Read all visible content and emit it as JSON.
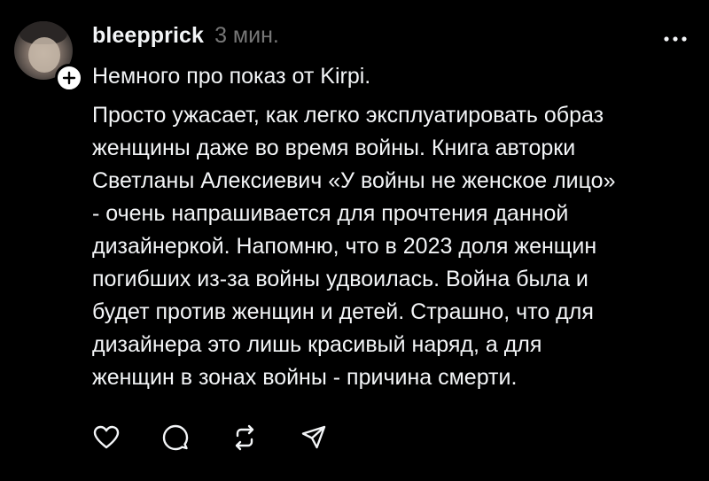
{
  "post": {
    "username": "bleepprick",
    "timestamp": "3 мин.",
    "lead": "Немного про показ от Kirpi.",
    "body_lines": [
      "Просто ужасает, как легко эксплуатировать образ",
      "женщины даже во время войны. Книга авторки",
      "Светланы Алексиевич «У войны не женское лицо»",
      "- очень напрашивается для прочтения данной",
      "дизайнеркой. Напомню, что в 2023 доля женщин",
      "погибших из-за войны удвоилась. Война была и",
      "будет против женщин и детей. Страшно, что для",
      "дизайнера это лишь красивый наряд, а для",
      "женщин в зонах войны - причина смерти."
    ]
  },
  "icons": {
    "avatar": "profile-photo",
    "follow": "plus-icon",
    "more": "ellipsis-icon",
    "like": "heart-icon",
    "reply": "comment-bubble-icon",
    "repost": "repost-arrows-icon",
    "share": "send-paper-plane-icon"
  },
  "colors": {
    "background": "#000000",
    "text": "#f3f5f7",
    "muted": "#777777",
    "icon": "#f3f5f7"
  }
}
